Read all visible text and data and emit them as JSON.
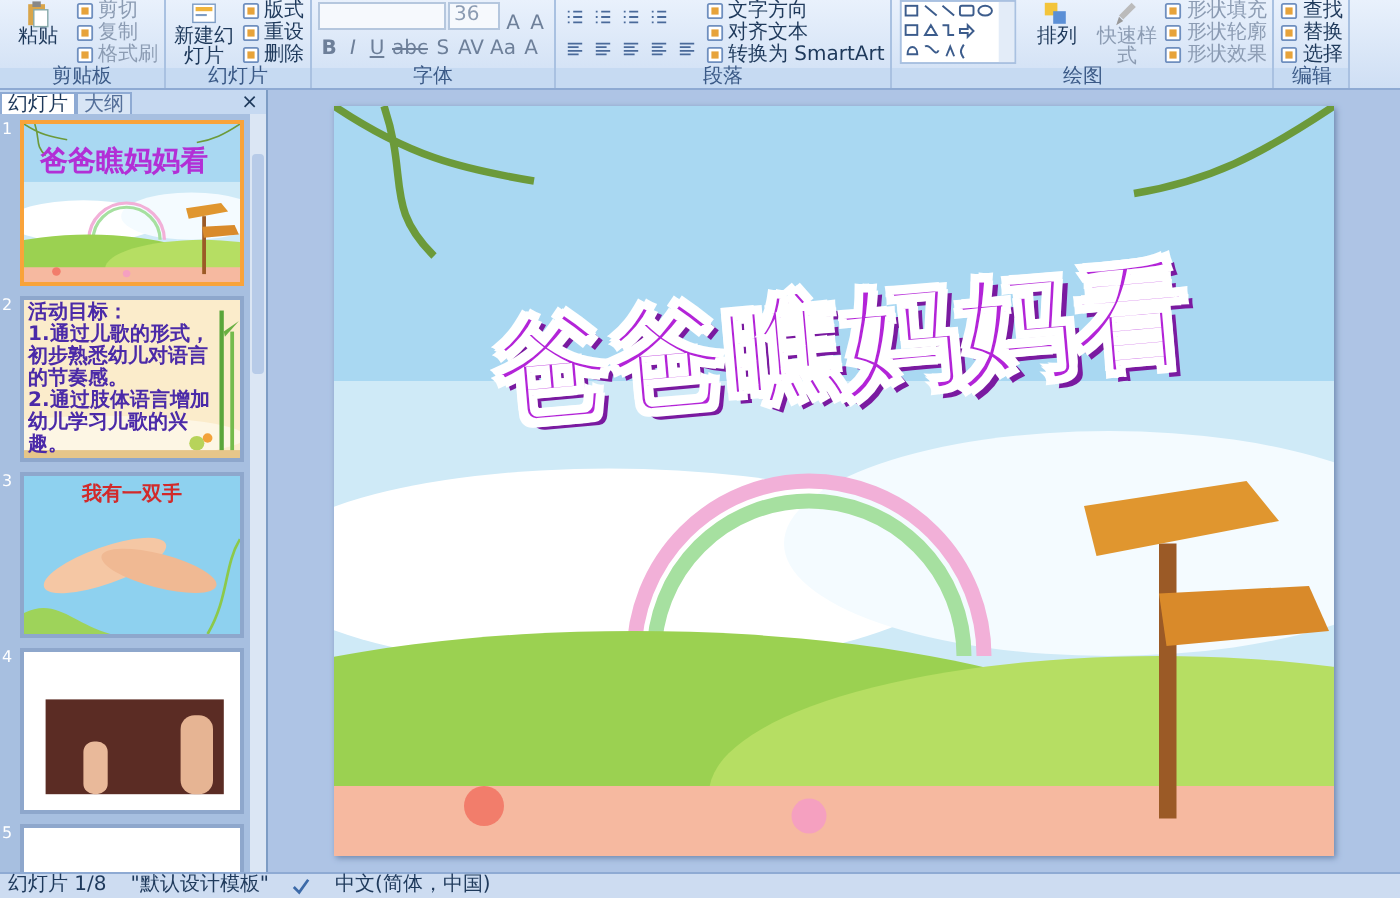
{
  "ribbon": [
    {
      "kind": "clipboard",
      "label": "剪贴板",
      "large": "粘贴",
      "commands": [
        {
          "label": "剪切",
          "disabled": true
        },
        {
          "label": "复制",
          "disabled": true
        },
        {
          "label": "格式刷",
          "disabled": true
        }
      ]
    },
    {
      "kind": "slides",
      "label": "幻灯片",
      "large": "新建幻灯片",
      "commands": [
        {
          "label": "版式",
          "disabled": false
        },
        {
          "label": "重设",
          "disabled": false
        },
        {
          "label": "删除",
          "disabled": false
        }
      ]
    },
    {
      "kind": "font",
      "label": "字体",
      "font_size": "36",
      "size_buttons": [
        "A",
        "A"
      ],
      "format_buttons": [
        "B",
        "I",
        "U",
        "abc",
        "S",
        "AV",
        "Aa",
        "A"
      ]
    },
    {
      "kind": "paragraph",
      "label": "段落",
      "commands": [
        {
          "label": "文字方向",
          "disabled": false
        },
        {
          "label": "对齐文本",
          "disabled": false
        },
        {
          "label": "转换为 SmartArt",
          "disabled": false
        }
      ]
    },
    {
      "kind": "drawing",
      "label": "绘图",
      "large": [
        {
          "label": "排列",
          "disabled": false
        },
        {
          "label": "快速样式",
          "disabled": true
        }
      ],
      "commands": [
        {
          "label": "形状填充",
          "disabled": true
        },
        {
          "label": "形状轮廓",
          "disabled": true
        },
        {
          "label": "形状效果",
          "disabled": true
        }
      ]
    },
    {
      "kind": "editing",
      "label": "编辑",
      "commands": [
        {
          "label": "查找",
          "disabled": false
        },
        {
          "label": "替换",
          "disabled": false
        },
        {
          "label": "选择",
          "disabled": false
        }
      ]
    }
  ],
  "panel_tabs": [
    {
      "label": "幻灯片",
      "selected": true
    },
    {
      "label": "大纲",
      "selected": false
    }
  ],
  "panel_close": "×",
  "slides": [
    {
      "number": "1",
      "selected": true,
      "kind": "meadow",
      "title": "爸爸瞧妈妈看"
    },
    {
      "number": "2",
      "selected": false,
      "kind": "desk",
      "heading": "活动目标：",
      "lines": [
        "1.通过儿歌的形式，初步熟悉幼儿对语言的节奏感。",
        "2.通过肢体语言增加幼儿学习儿歌的兴趣。"
      ]
    },
    {
      "number": "3",
      "selected": false,
      "kind": "hands",
      "title": "我有一双手"
    },
    {
      "number": "4",
      "selected": false,
      "kind": "brown"
    },
    {
      "number": "5",
      "selected": false,
      "kind": "people"
    }
  ],
  "current_slide": {
    "kind": "meadow",
    "title": "爸爸瞧妈妈看"
  },
  "status_bar": {
    "slide": "幻灯片 1/8",
    "theme": "\"默认设计模板\"",
    "language": "中文(简体，中国)"
  }
}
